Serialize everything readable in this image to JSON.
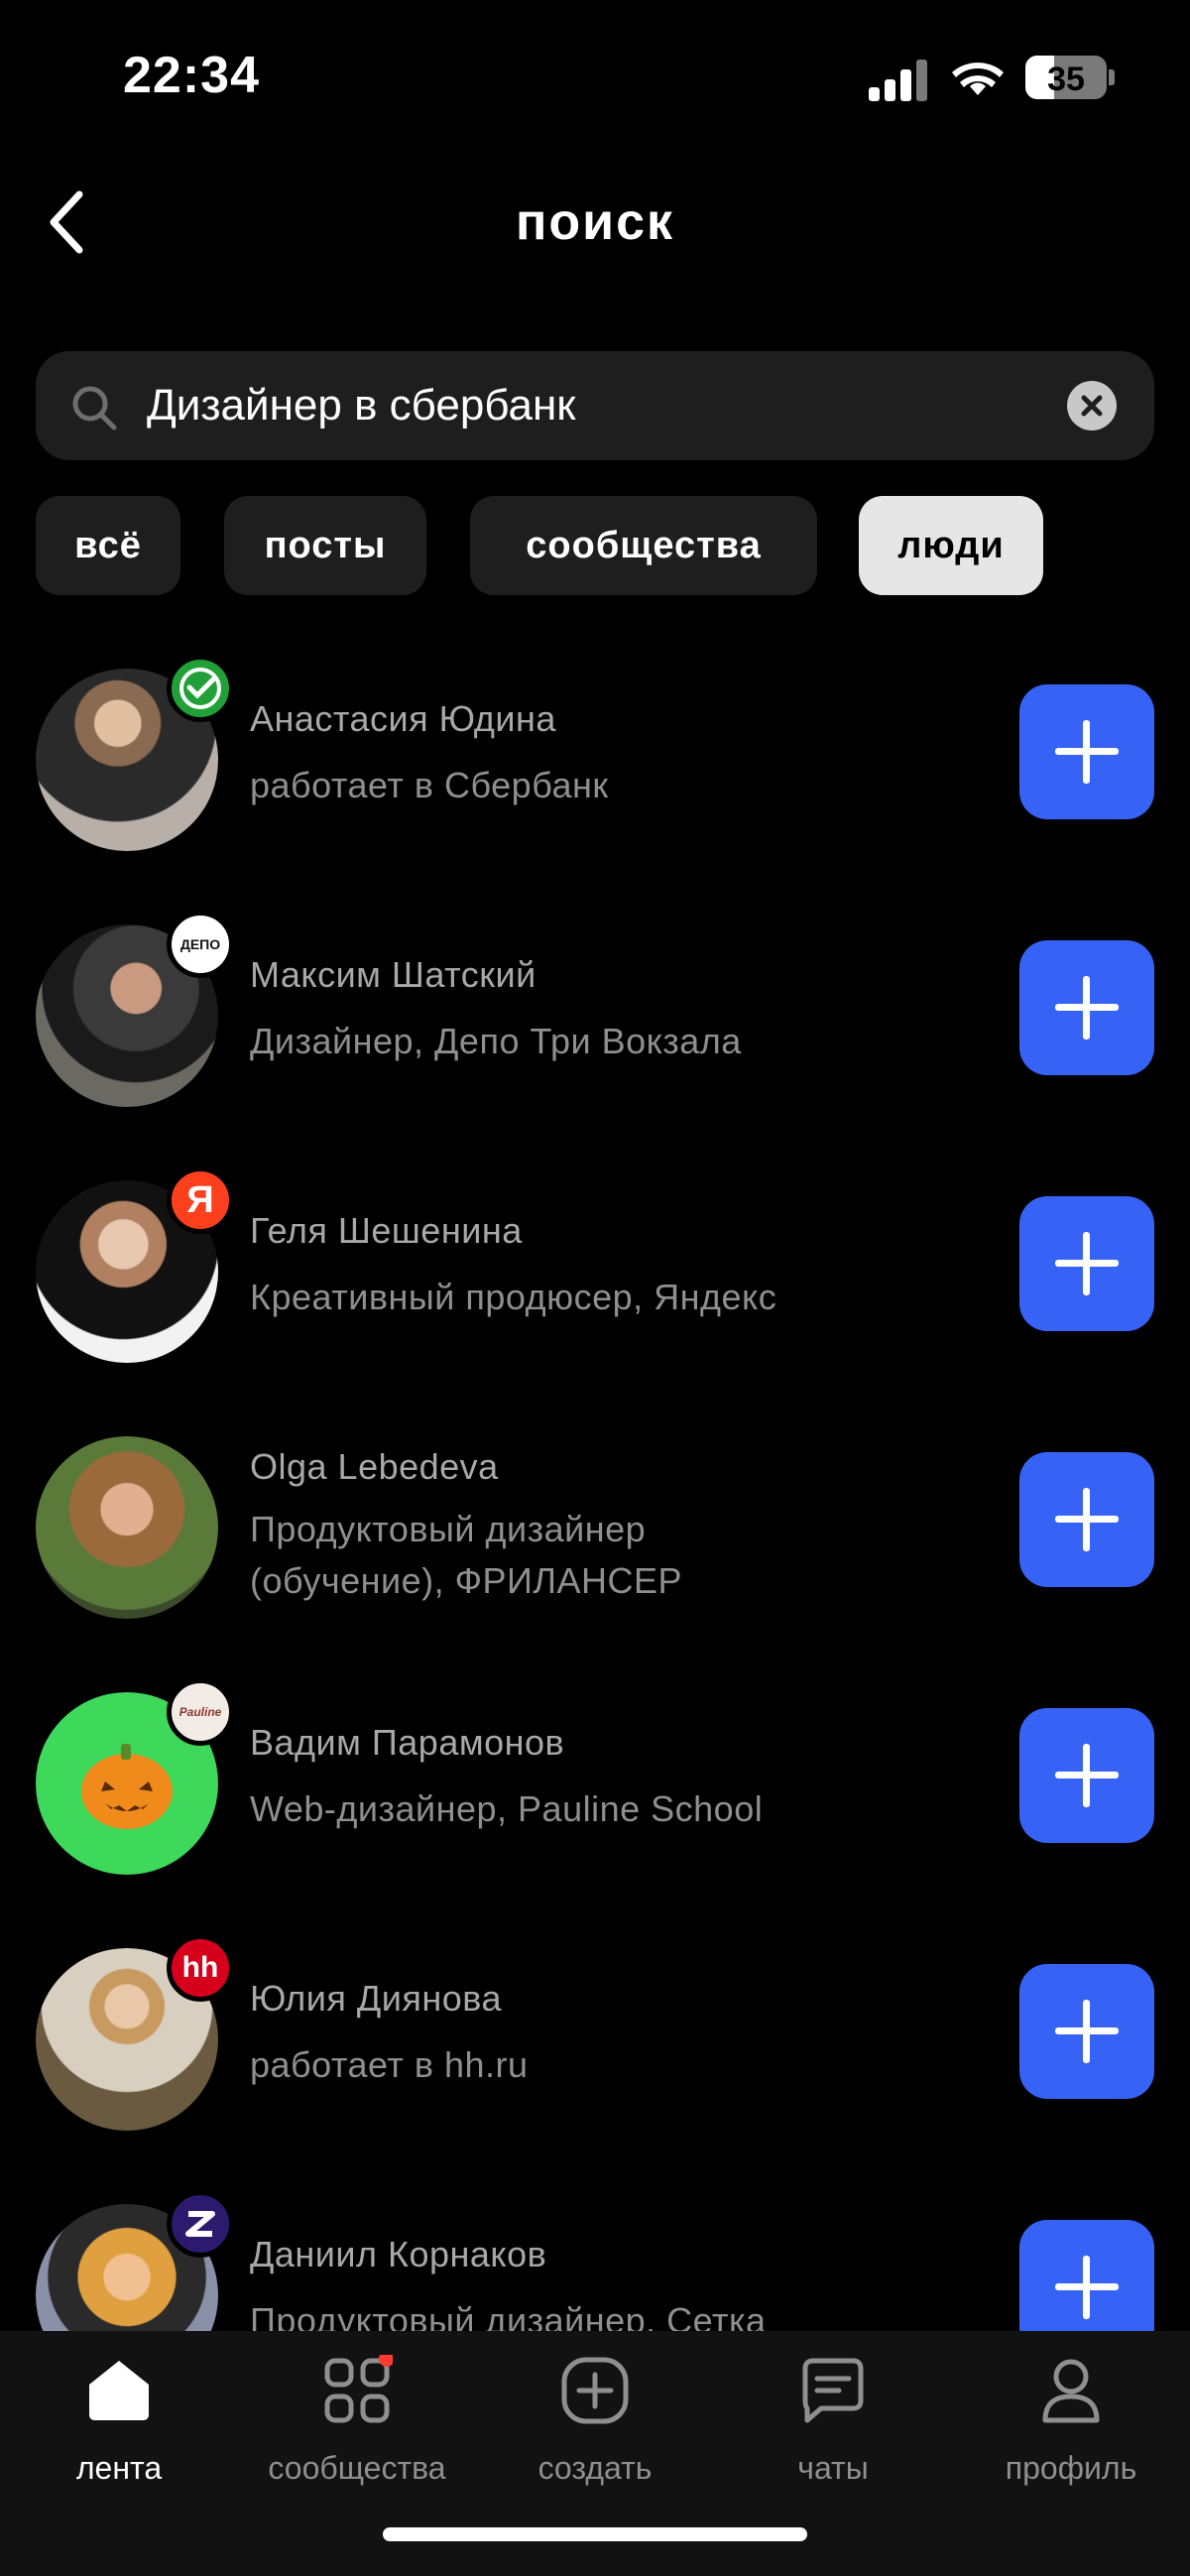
{
  "status_bar": {
    "time": "22:34",
    "battery": "35"
  },
  "header": {
    "title": "поиск"
  },
  "search": {
    "value": "Дизайнер в сбербанк"
  },
  "filters": [
    {
      "label": "всё",
      "active": false
    },
    {
      "label": "посты",
      "active": false
    },
    {
      "label": "сообщества",
      "active": false
    },
    {
      "label": "люди",
      "active": true
    }
  ],
  "people": [
    {
      "name": "Анастасия Юдина",
      "role": "работает в Сбербанк",
      "badge": "sber-logo-icon",
      "badge_color": "#21a038"
    },
    {
      "name": "Максим Шатский",
      "role": "Дизайнер, Депо Три Вокзала",
      "badge": "ДЕПО",
      "badge_color": "#ffffff"
    },
    {
      "name": "Геля Шешенина",
      "role": "Креативный продюсер, Яндекс",
      "badge": "Я",
      "badge_color": "#fc3f1d"
    },
    {
      "name": "Olga Lebedeva",
      "role": "Продуктовый дизайнер (обучение), ФРИЛАНСЕР",
      "badge": "",
      "badge_color": ""
    },
    {
      "name": "Вадим Парамонов",
      "role": "Web-дизайнер, Pauline School",
      "badge": "Pauline",
      "badge_color": "#f3ece6"
    },
    {
      "name": "Юлия Диянова",
      "role": "работает в hh.ru",
      "badge": "hh",
      "badge_color": "#d6001c"
    },
    {
      "name": "Даниил Корнаков",
      "role": "Продуктовый дизайнер, Сетка",
      "badge": "setka-logo-icon",
      "badge_color": "#2b1a6e"
    }
  ],
  "tabbar": [
    {
      "label": "лента",
      "icon": "home-icon",
      "active": true
    },
    {
      "label": "сообщества",
      "icon": "grid-icon",
      "active": false,
      "dot": true
    },
    {
      "label": "создать",
      "icon": "plus-square-icon",
      "active": false
    },
    {
      "label": "чаты",
      "icon": "chat-icon",
      "active": false
    },
    {
      "label": "профиль",
      "icon": "profile-icon",
      "active": false
    }
  ],
  "colors": {
    "accent": "#3663f5",
    "background": "#000000",
    "surface": "#1e1e1e"
  }
}
